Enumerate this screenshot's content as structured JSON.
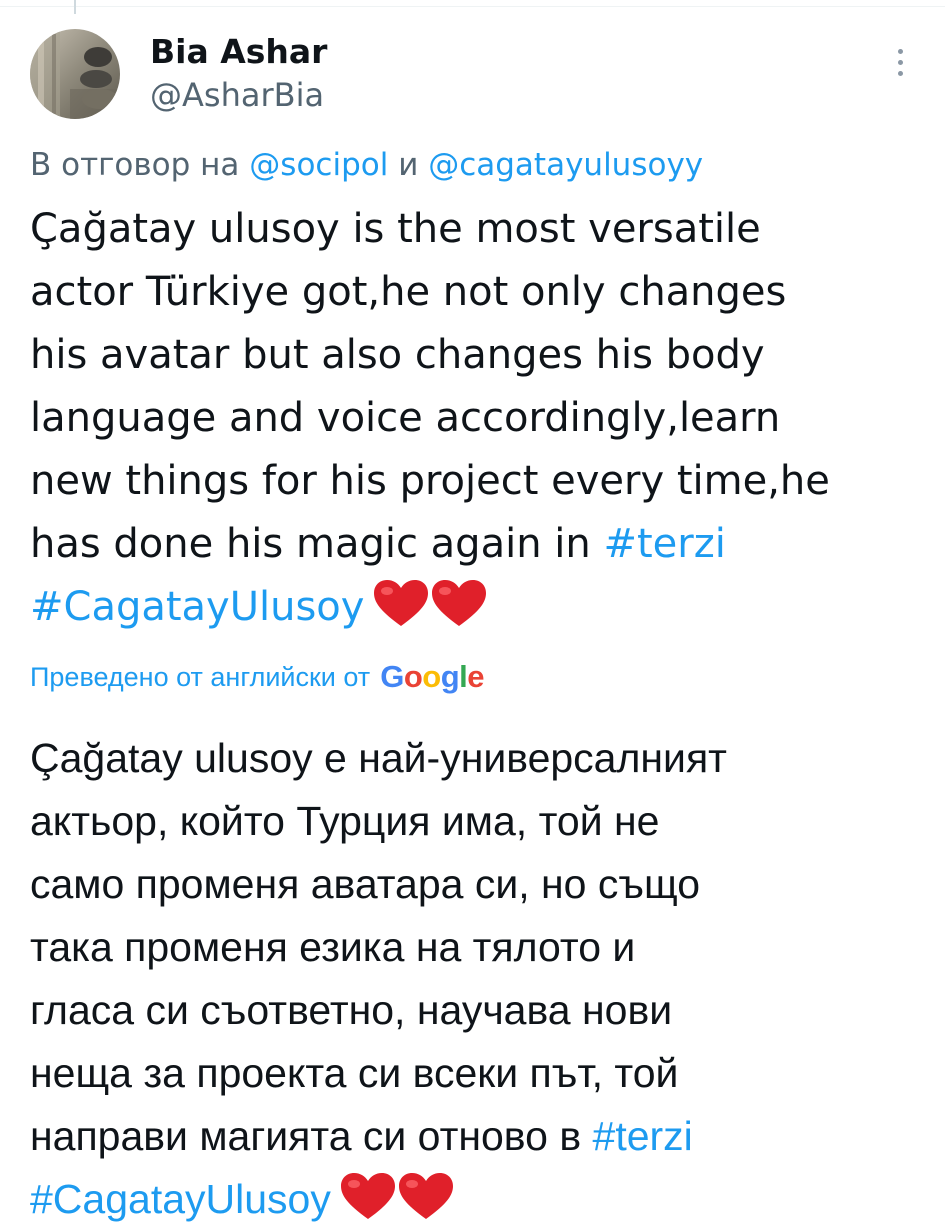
{
  "author": {
    "display_name": "Bia Ashar",
    "handle": "@AsharBia"
  },
  "reply_to": {
    "prefix": "В отговор на",
    "mention_1": "@socipol",
    "conjunction": "и",
    "mention_2": "@cagatayulusoyy"
  },
  "tweet": {
    "original_lines": [
      "Çağatay ulusoy is the most versatile",
      "actor Türkiye got,he not only changes",
      "his avatar but also changes his body",
      "language and voice accordingly,learn",
      "new things for his project every time,he",
      "has done his magic again in"
    ],
    "original_hashtag_1": "#terzi",
    "original_hashtag_2": "#CagatayUlusoy",
    "translation_note": "Преведено от английски от",
    "translation_provider": "Google",
    "translated_lines": [
      "Çağatay ulusoy е най-универсалният",
      "актьор, който Турция има, той не",
      "само променя аватара си, но също",
      "така променя езика на тялото и",
      "гласа си съответно, научава нови",
      "неща за проекта си всеки път, той",
      "направи магията си отново в"
    ],
    "translated_hashtag_1": "#terzi",
    "translated_hashtag_2": "#CagatayUlusoy",
    "emoji": [
      "❤️",
      "❤️"
    ]
  },
  "icons": {
    "more": "more-vertical-icon",
    "heart": "red-heart-icon"
  },
  "colors": {
    "link": "#1d9bf0",
    "text": "#0f1419",
    "secondary": "#536471",
    "heart": "#e0202a"
  }
}
